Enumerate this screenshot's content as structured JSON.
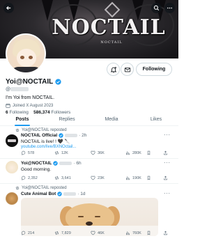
{
  "banner": {
    "logo_text": "NOCTAIL",
    "logo_sub": "NOCTAIL"
  },
  "profile": {
    "name": "Yoi@NOCTAIL",
    "handle_prefix": "@",
    "bio": "I'm Yoi from NOCTAIL.",
    "joined": "Joined X August 2023",
    "following_count": "6",
    "following_label": "Following",
    "followers_count": "586,374",
    "followers_label": "Followers",
    "follow_button": "Following"
  },
  "tabs": [
    "Posts",
    "Replies",
    "Media",
    "Likes"
  ],
  "posts": [
    {
      "repost_label": "Yoi@NOCTAIL reposted",
      "author": "NOCTAIL Official",
      "time": "· 2h",
      "text": "NOCTAIL is live! ! 🖤 🔪",
      "link": "youtube.com/live/BXNOctail...",
      "reply": "578",
      "repost": "12K",
      "like": "36K",
      "views": "280K"
    },
    {
      "author": "Yoi@NOCTAIL",
      "time": "· 6h",
      "text": "Good morning.",
      "reply": "2,352",
      "repost": "3,641",
      "like": "23K",
      "views": "190K"
    },
    {
      "repost_label": "Yoi@NOCTAIL reposted",
      "author": "Cute Animal Bot",
      "time": "· 1d",
      "reply": "214",
      "repost": "7,829",
      "like": "46K",
      "views": "760K"
    }
  ],
  "colors": {
    "accent": "#1d9bf0",
    "text": "#0f1419",
    "muted": "#536471"
  }
}
